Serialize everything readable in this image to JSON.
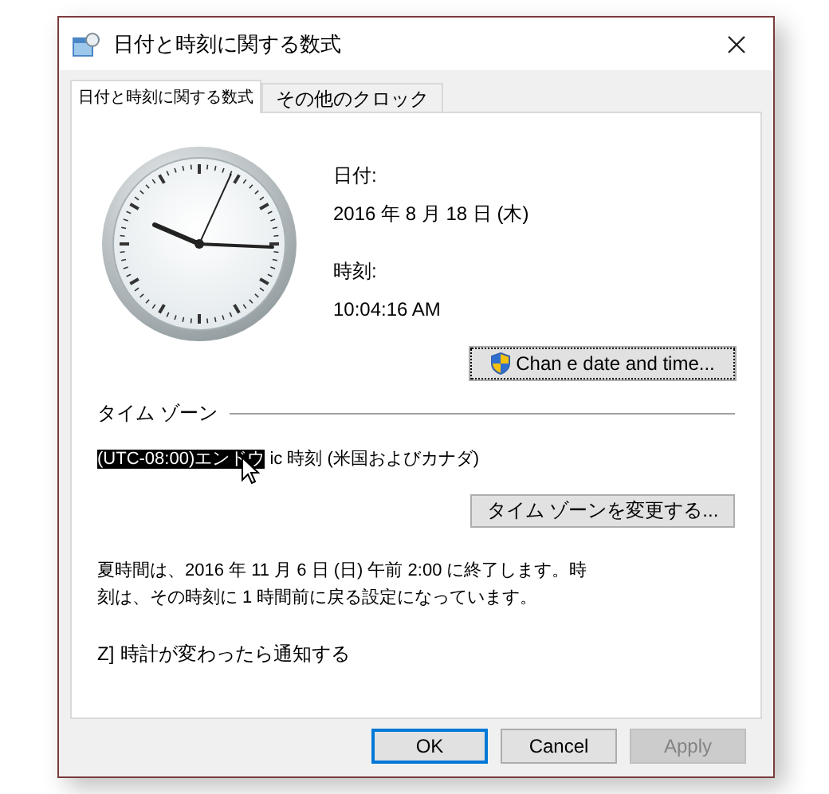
{
  "window": {
    "title": "日付と時刻に関する数式"
  },
  "tabs": [
    {
      "label": "日付と時刻に関する数式",
      "selected": true
    },
    {
      "label": "その他のクロック",
      "selected": false
    }
  ],
  "date": {
    "label": "日付:",
    "value": "2016 年 8 月 18 日 (木)"
  },
  "time": {
    "label": "時刻:",
    "value": "10:04:16 AM"
  },
  "change_datetime_button": "Chan e date and time...",
  "time_zone": {
    "heading": "タイム ゾーン",
    "selected_part": "(UTC-08:00)エンドウ",
    "rest": "ic 時刻 (米国およびカナダ)",
    "change_button": "タイム ゾーンを変更する..."
  },
  "dst_note": "夏時間は、2016 年 11 月 6 日 (日) 午前 2:00 に終了します。時刻は、その時刻に 1 時間前に戻る設定になっています。",
  "notify": {
    "mark": "Z]",
    "label": "時計が変わったら通知する"
  },
  "buttons": [
    {
      "label": "OK",
      "default": true,
      "disabled": false
    },
    {
      "label": "Cancel",
      "default": false,
      "disabled": false
    },
    {
      "label": "Apply",
      "default": false,
      "disabled": true
    }
  ]
}
